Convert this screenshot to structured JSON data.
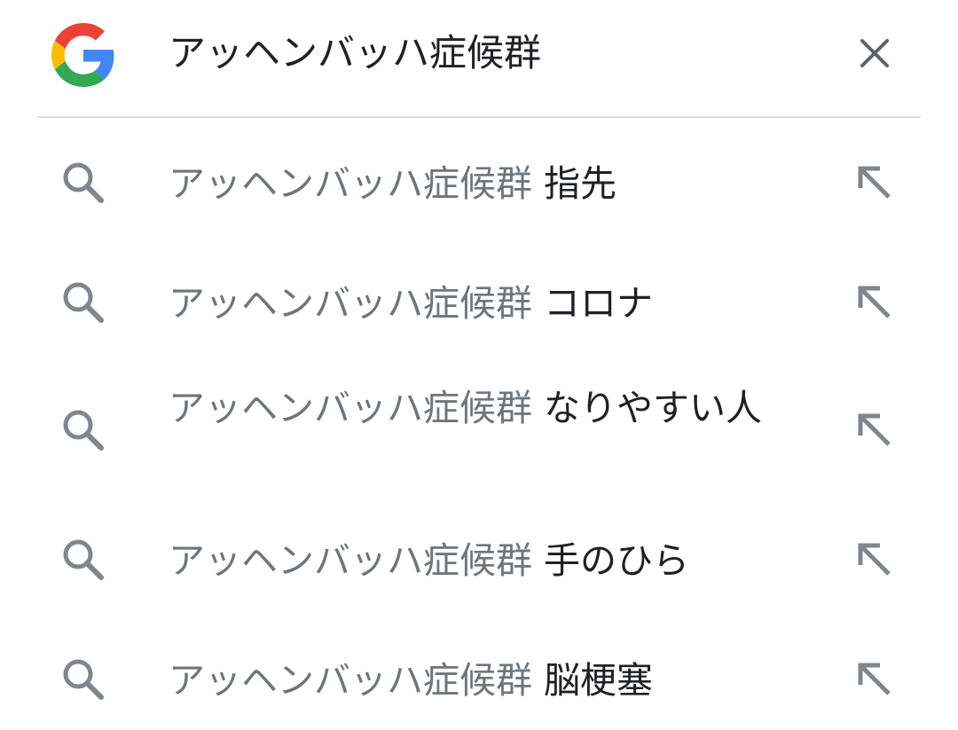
{
  "search": {
    "query": "アッヘンバッハ症候群",
    "clear_icon": "close-icon",
    "logo_icon": "google-g-logo"
  },
  "colors": {
    "g_blue": "#4285F4",
    "g_red": "#EA4335",
    "g_yellow": "#FBBC05",
    "g_green": "#34A853",
    "icon_gray": "#80868b",
    "text_dark": "#202124",
    "text_gray": "#70757a"
  },
  "suggestions": [
    {
      "prefix": "アッヘンバッハ症候群",
      "suffix": "指先",
      "icon": "search-icon",
      "action_icon": "arrow-up-left-icon"
    },
    {
      "prefix": "アッヘンバッハ症候群",
      "suffix": "コロナ",
      "icon": "search-icon",
      "action_icon": "arrow-up-left-icon"
    },
    {
      "prefix": "アッヘンバッハ症候群",
      "suffix": "なりやすい人",
      "icon": "search-icon",
      "action_icon": "arrow-up-left-icon"
    },
    {
      "prefix": "アッヘンバッハ症候群",
      "suffix": "手のひら",
      "icon": "search-icon",
      "action_icon": "arrow-up-left-icon"
    },
    {
      "prefix": "アッヘンバッハ症候群",
      "suffix": "脳梗塞",
      "icon": "search-icon",
      "action_icon": "arrow-up-left-icon"
    }
  ]
}
